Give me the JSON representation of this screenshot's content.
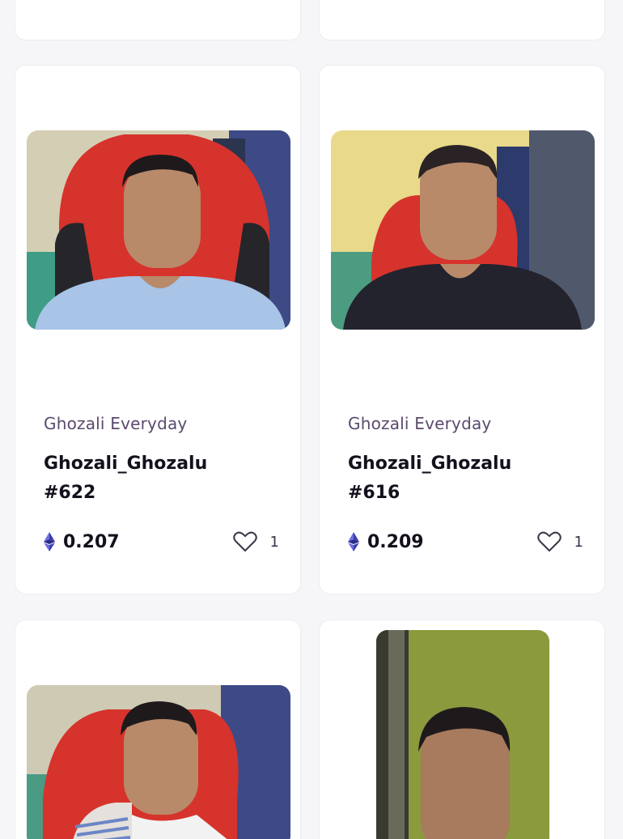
{
  "cards": [
    {
      "collection": "Ghozali Everyday",
      "title_line1": "Ghozali_Ghozalu",
      "title_line2": "#622",
      "price": "0.207",
      "likes": "1",
      "icons": {
        "currency": "ethereum-icon",
        "like": "heart-icon"
      },
      "thumbnail": "person-red-gaming-chair-light-blue-shirt"
    },
    {
      "collection": "Ghozali Everyday",
      "title_line1": "Ghozali_Ghozalu",
      "title_line2": "#616",
      "price": "0.209",
      "likes": "1",
      "icons": {
        "currency": "ethereum-icon",
        "like": "heart-icon"
      },
      "thumbnail": "person-red-gaming-chair-dark-shirt"
    }
  ],
  "partial_cards": [
    {
      "thumbnail": "person-red-gaming-chair-white-shirt"
    },
    {
      "thumbnail": "person-close-up-green-wall"
    }
  ],
  "colors": {
    "ethereum": "#5b5bd6",
    "chair_red": "#d6332c",
    "background": "#f6f6f9"
  }
}
